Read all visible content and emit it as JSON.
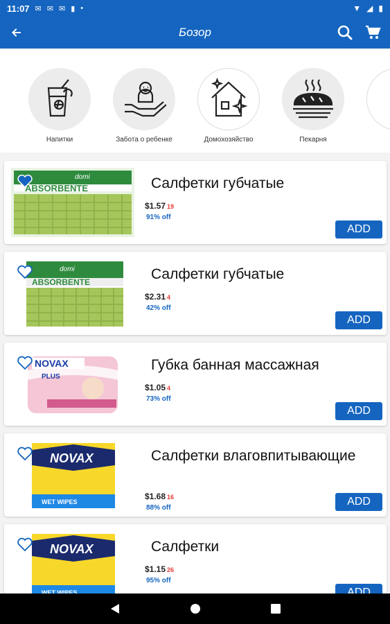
{
  "status_bar": {
    "time": "11:07",
    "notification_icons": [
      "mail-icon",
      "mail-icon",
      "mail-icon",
      "sd-card-icon",
      "dot-icon"
    ],
    "right_icons": [
      "wifi-icon",
      "signal-icon",
      "battery-icon"
    ]
  },
  "app_bar": {
    "title": "Бозор",
    "back_icon": "back-arrow-icon",
    "search_icon": "search-icon",
    "cart_icon": "cart-icon"
  },
  "categories": [
    {
      "label": "Напитки",
      "icon": "drink-icon"
    },
    {
      "label": "Забота о ребенке",
      "icon": "baby-care-icon"
    },
    {
      "label": "Домохозяйство",
      "icon": "house-icon"
    },
    {
      "label": "Пекарня",
      "icon": "bread-icon"
    }
  ],
  "products": [
    {
      "name": "Салфетки губчатые",
      "price": "$1.57",
      "old_price": "19",
      "discount": "91% off",
      "add_label": "ADD",
      "image": "absorbente-sponge-cloth"
    },
    {
      "name": "Салфетки губчатые",
      "price": "$2.31",
      "old_price": "4",
      "discount": "42% off",
      "add_label": "ADD",
      "image": "absorbente-sponge-cloth"
    },
    {
      "name": "Губка банная массажная",
      "price": "$1.05",
      "old_price": "4",
      "discount": "73% off",
      "add_label": "ADD",
      "image": "novax-bath-sponge"
    },
    {
      "name": "Салфетки влаговпитывающие",
      "price": "$1.68",
      "old_price": "16",
      "discount": "88% off",
      "add_label": "ADD",
      "image": "novax-wet-wipes"
    },
    {
      "name": "Салфетки",
      "price": "$1.15",
      "old_price": "26",
      "discount": "95% off",
      "add_label": "ADD",
      "image": "novax-wet-wipes"
    }
  ],
  "image_text": {
    "dom": "domi",
    "absorbente": "ABSORBENTE",
    "novax": "NOVAX",
    "plus": "PLUS",
    "wet_wipes": "WET WIPES"
  },
  "colors": {
    "primary": "#1565c0",
    "old_price": "#e53935"
  }
}
